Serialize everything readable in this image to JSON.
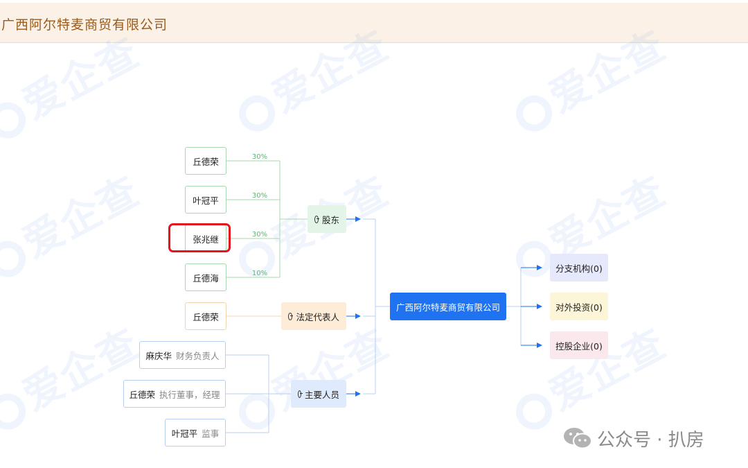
{
  "header": {
    "title": "广西阿尔特麦商贸有限公司"
  },
  "watermark": {
    "text": "爱企查"
  },
  "diagram": {
    "shareholder_group": "股东",
    "legal_group": "法定代表人",
    "staff_group": "主要人员",
    "shareholders": [
      {
        "name": "丘德荣",
        "share": "30%"
      },
      {
        "name": "叶冠平",
        "share": "30%"
      },
      {
        "name": "张兆继",
        "share": "30%"
      },
      {
        "name": "丘德海",
        "share": "10%"
      }
    ],
    "legal_representative": {
      "name": "丘德荣"
    },
    "staff": [
      {
        "name": "麻庆华",
        "role": "财务负责人"
      },
      {
        "name": "丘德荣",
        "role": "执行董事，经理"
      },
      {
        "name": "叶冠平",
        "role": "监事"
      }
    ],
    "company": "广西阿尔特麦商贸有限公司",
    "outputs": [
      {
        "label": "分支机构(0)"
      },
      {
        "label": "对外投资(0)"
      },
      {
        "label": "控股企业(0)"
      }
    ]
  },
  "colors": {
    "company": "#1f72f0",
    "shareholder_line": "#a7d9ae",
    "legal_line": "#f3d3ad",
    "staff_line": "#b8cff2",
    "highlight": "#e3141c"
  },
  "brand": {
    "text": "公众号 · 扒房"
  }
}
